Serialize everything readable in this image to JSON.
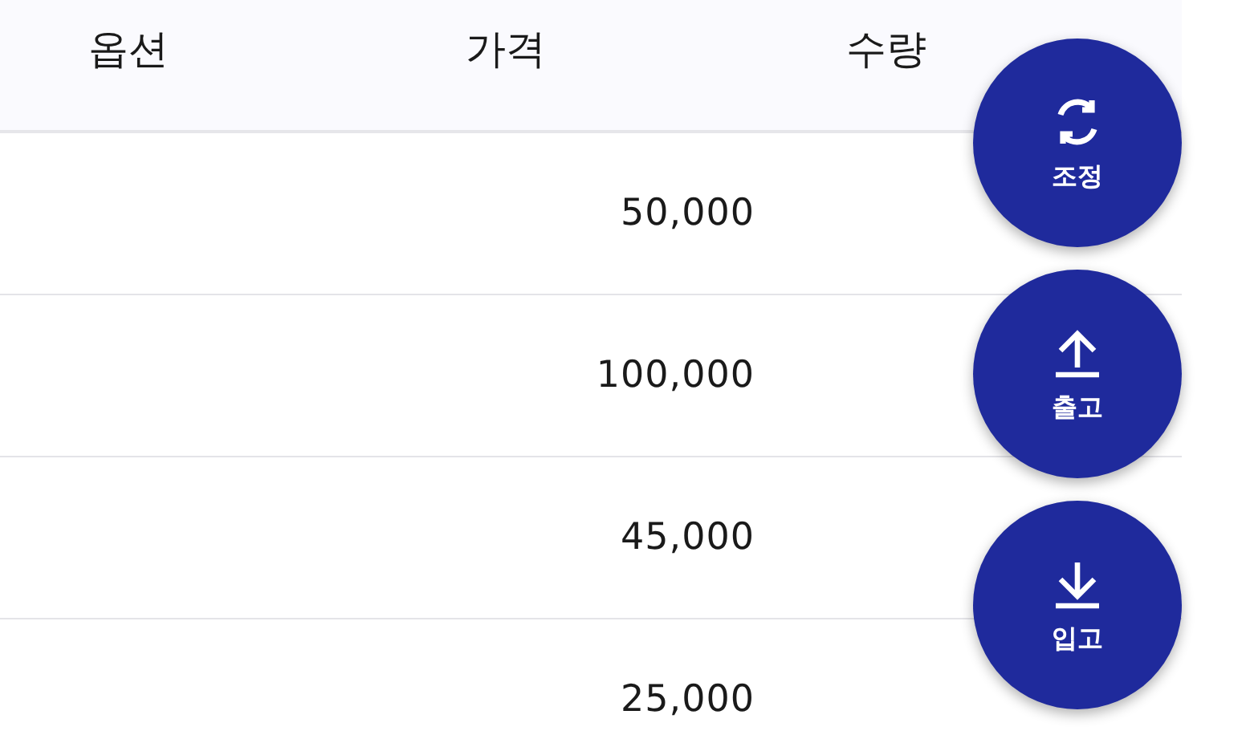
{
  "table": {
    "columns": [
      "옵션",
      "가격",
      "수량"
    ],
    "rows": [
      {
        "price": "50,000"
      },
      {
        "price": "100,000"
      },
      {
        "price": "45,000"
      },
      {
        "price": "25,000"
      }
    ]
  },
  "actions": [
    {
      "kind": "adjust",
      "label": "조정"
    },
    {
      "kind": "outbound",
      "label": "출고"
    },
    {
      "kind": "inbound",
      "label": "입고"
    }
  ]
}
